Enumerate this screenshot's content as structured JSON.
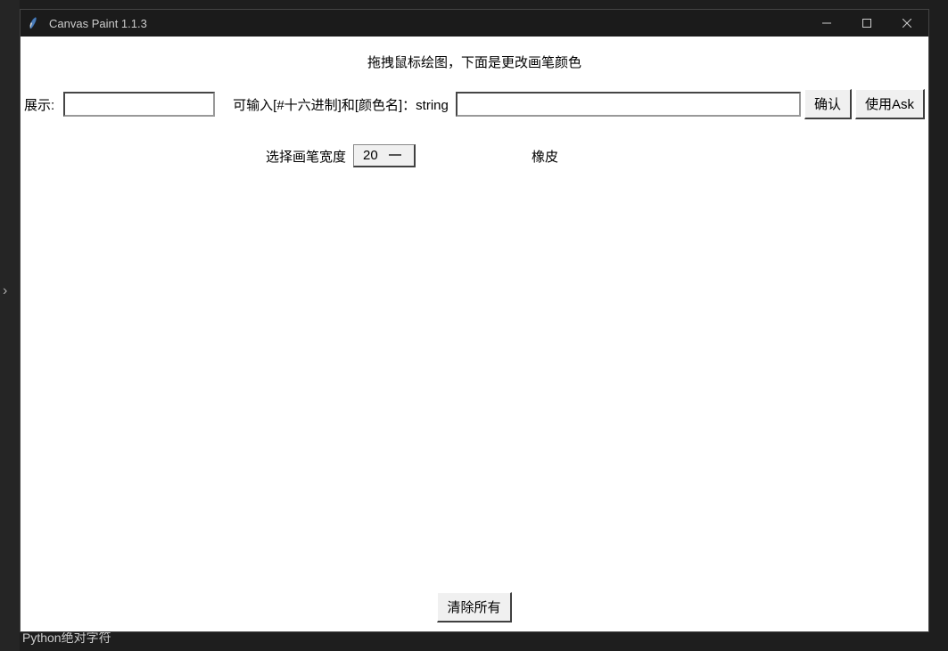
{
  "window": {
    "title": "Canvas Paint 1.1.3"
  },
  "instruction": "拖拽鼠标绘图，下面是更改画笔颜色",
  "displayLabel": "展示:",
  "hexInputLabel": "可输入[#十六进制]和[颜色名]：string",
  "colorValue": "",
  "confirmButton": "确认",
  "useAskButton": "使用Ask",
  "widthLabel": "选择画笔宽度",
  "widthValue": "20",
  "eraserLabel": "橡皮",
  "clearButton": "清除所有",
  "bg": {
    "bottomText": "Python绝对字符"
  }
}
